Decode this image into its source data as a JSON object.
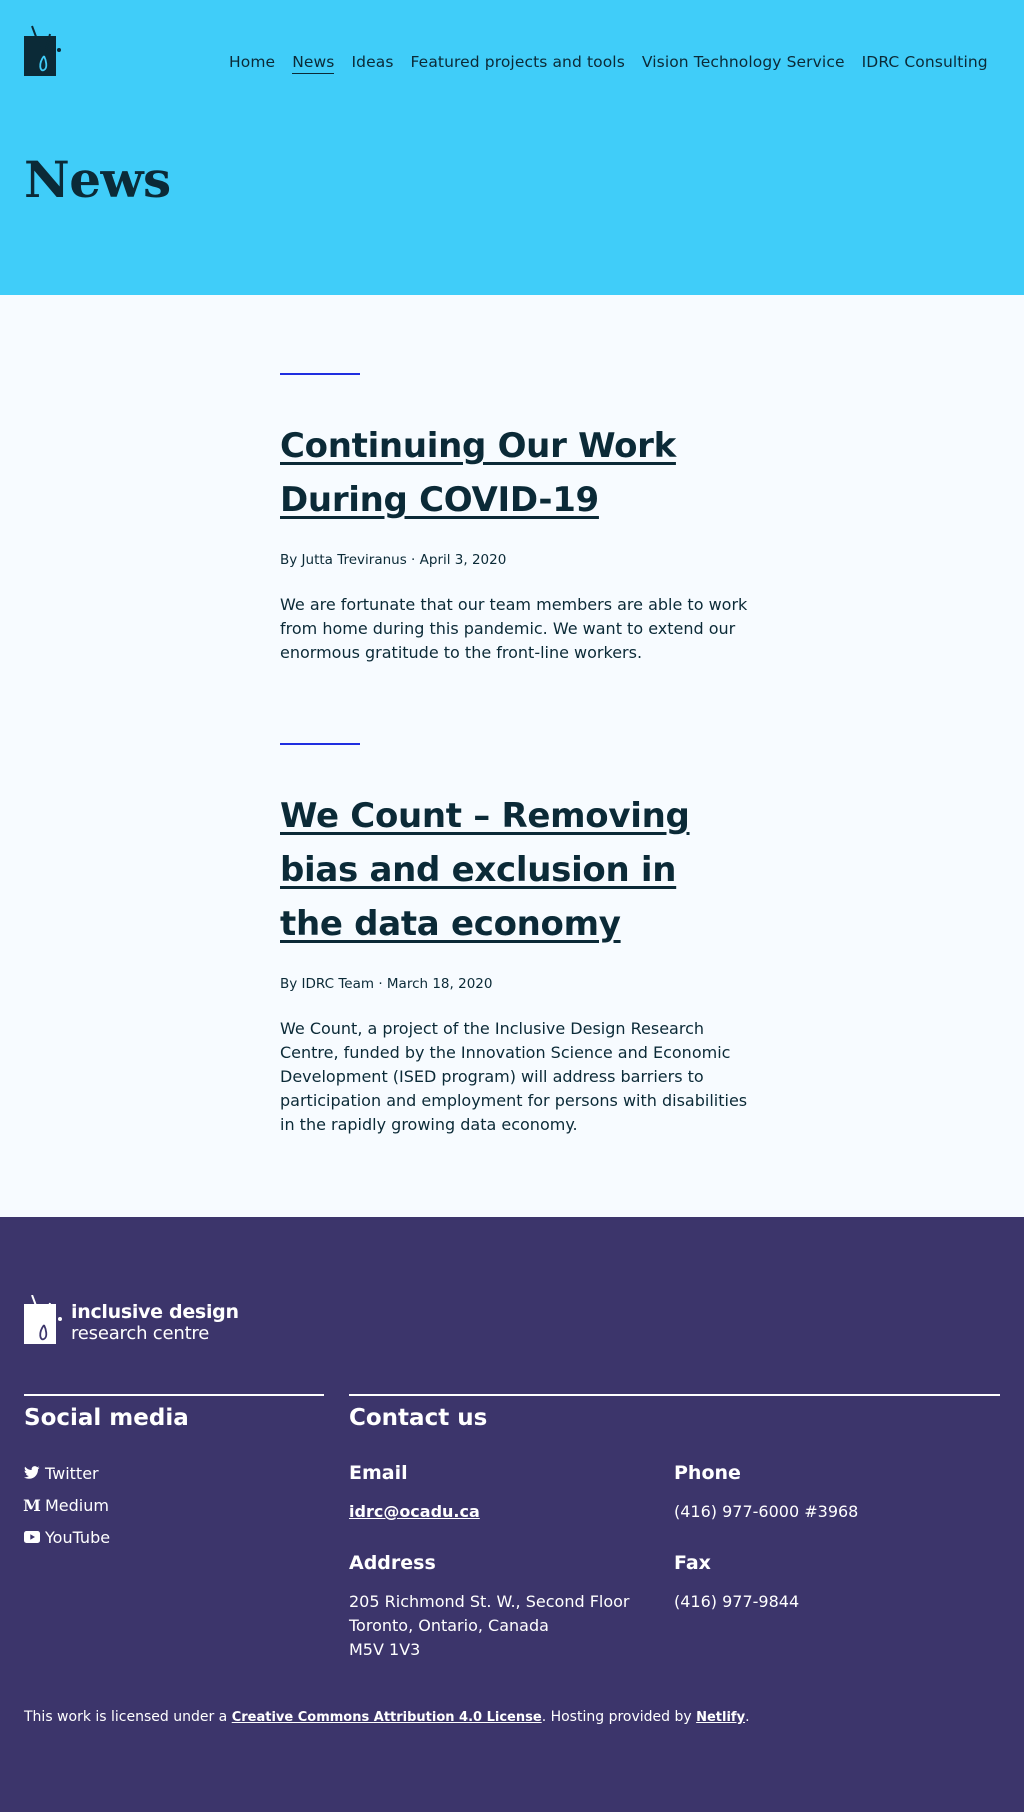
{
  "nav": {
    "items": [
      {
        "label": "Home"
      },
      {
        "label": "News"
      },
      {
        "label": "Ideas"
      },
      {
        "label": "Featured projects and tools"
      },
      {
        "label": "Vision Technology Service"
      },
      {
        "label": "IDRC Consulting"
      }
    ],
    "active": "News"
  },
  "page": {
    "title": "News"
  },
  "articles": [
    {
      "title": "Continuing Our Work During COVID-19",
      "meta": "By Jutta Treviranus · April 3, 2020",
      "excerpt": "We are fortunate that our team members are able to work from home during this pandemic. We want to extend our enormous gratitude to the front-line workers."
    },
    {
      "title": "We Count – Removing bias and exclusion in the data economy",
      "meta": "By IDRC Team · March 18, 2020",
      "excerpt": "We Count, a project of the Inclusive Design Research Centre, funded by the Innovation Science and Economic Development (ISED program) will address barriers to participation and employment for persons with disabilities in the rapidly growing data economy."
    }
  ],
  "footer": {
    "logo": {
      "line1": "inclusive design",
      "line2": "research centre"
    },
    "social": {
      "heading": "Social media",
      "items": [
        {
          "label": "Twitter",
          "icon": "twitter-icon"
        },
        {
          "label": "Medium",
          "icon": "medium-icon"
        },
        {
          "label": "YouTube",
          "icon": "youtube-icon"
        }
      ]
    },
    "contact": {
      "heading": "Contact us",
      "email_heading": "Email",
      "email": "idrc@ocadu.ca",
      "phone_heading": "Phone",
      "phone": "(416) 977-6000 #3968",
      "address_heading": "Address",
      "address_line1": "205 Richmond St. W., Second Floor",
      "address_line2": "Toronto, Ontario, Canada",
      "address_line3": "M5V 1V3",
      "fax_heading": "Fax",
      "fax": "(416) 977-9844"
    },
    "license": {
      "prefix": "This work is licensed under a ",
      "license_link": "Creative Commons Attribution 4.0 License",
      "middle": ". Hosting provided by ",
      "host_link": "Netlify",
      "suffix": "."
    }
  },
  "colors": {
    "header_bg": "#40cdf9",
    "body_bg": "#f7fbff",
    "footer_bg": "#3c356b",
    "text_dark": "#0b2a37",
    "accent_rule": "#1f2ee0"
  }
}
